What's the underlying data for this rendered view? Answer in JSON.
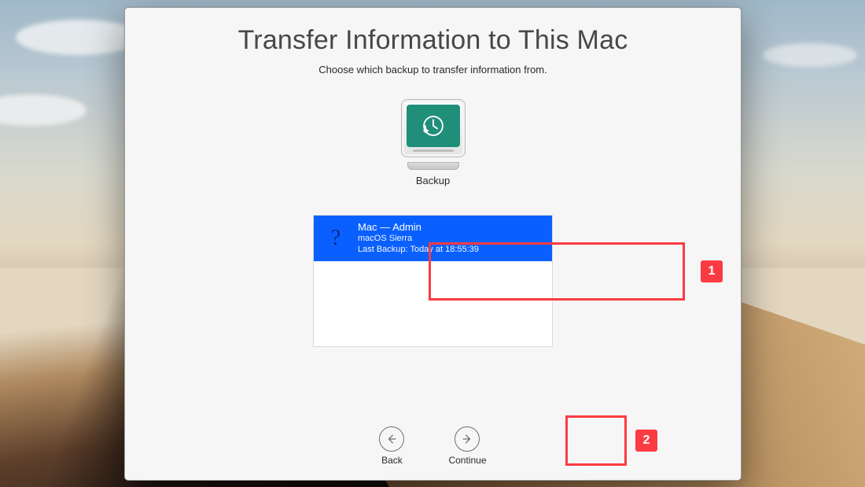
{
  "window": {
    "title": "Transfer Information to This Mac",
    "subtitle": "Choose which backup to transfer information from."
  },
  "disk": {
    "label": "Backup",
    "icon": "time-machine"
  },
  "backups": [
    {
      "title": "Mac — Admin",
      "os": "macOS Sierra",
      "last_backup": "Last Backup: Today at 18:55:39",
      "selected": true
    }
  ],
  "nav": {
    "back": "Back",
    "continue": "Continue"
  },
  "annotations": {
    "step1": "1",
    "step2": "2"
  }
}
